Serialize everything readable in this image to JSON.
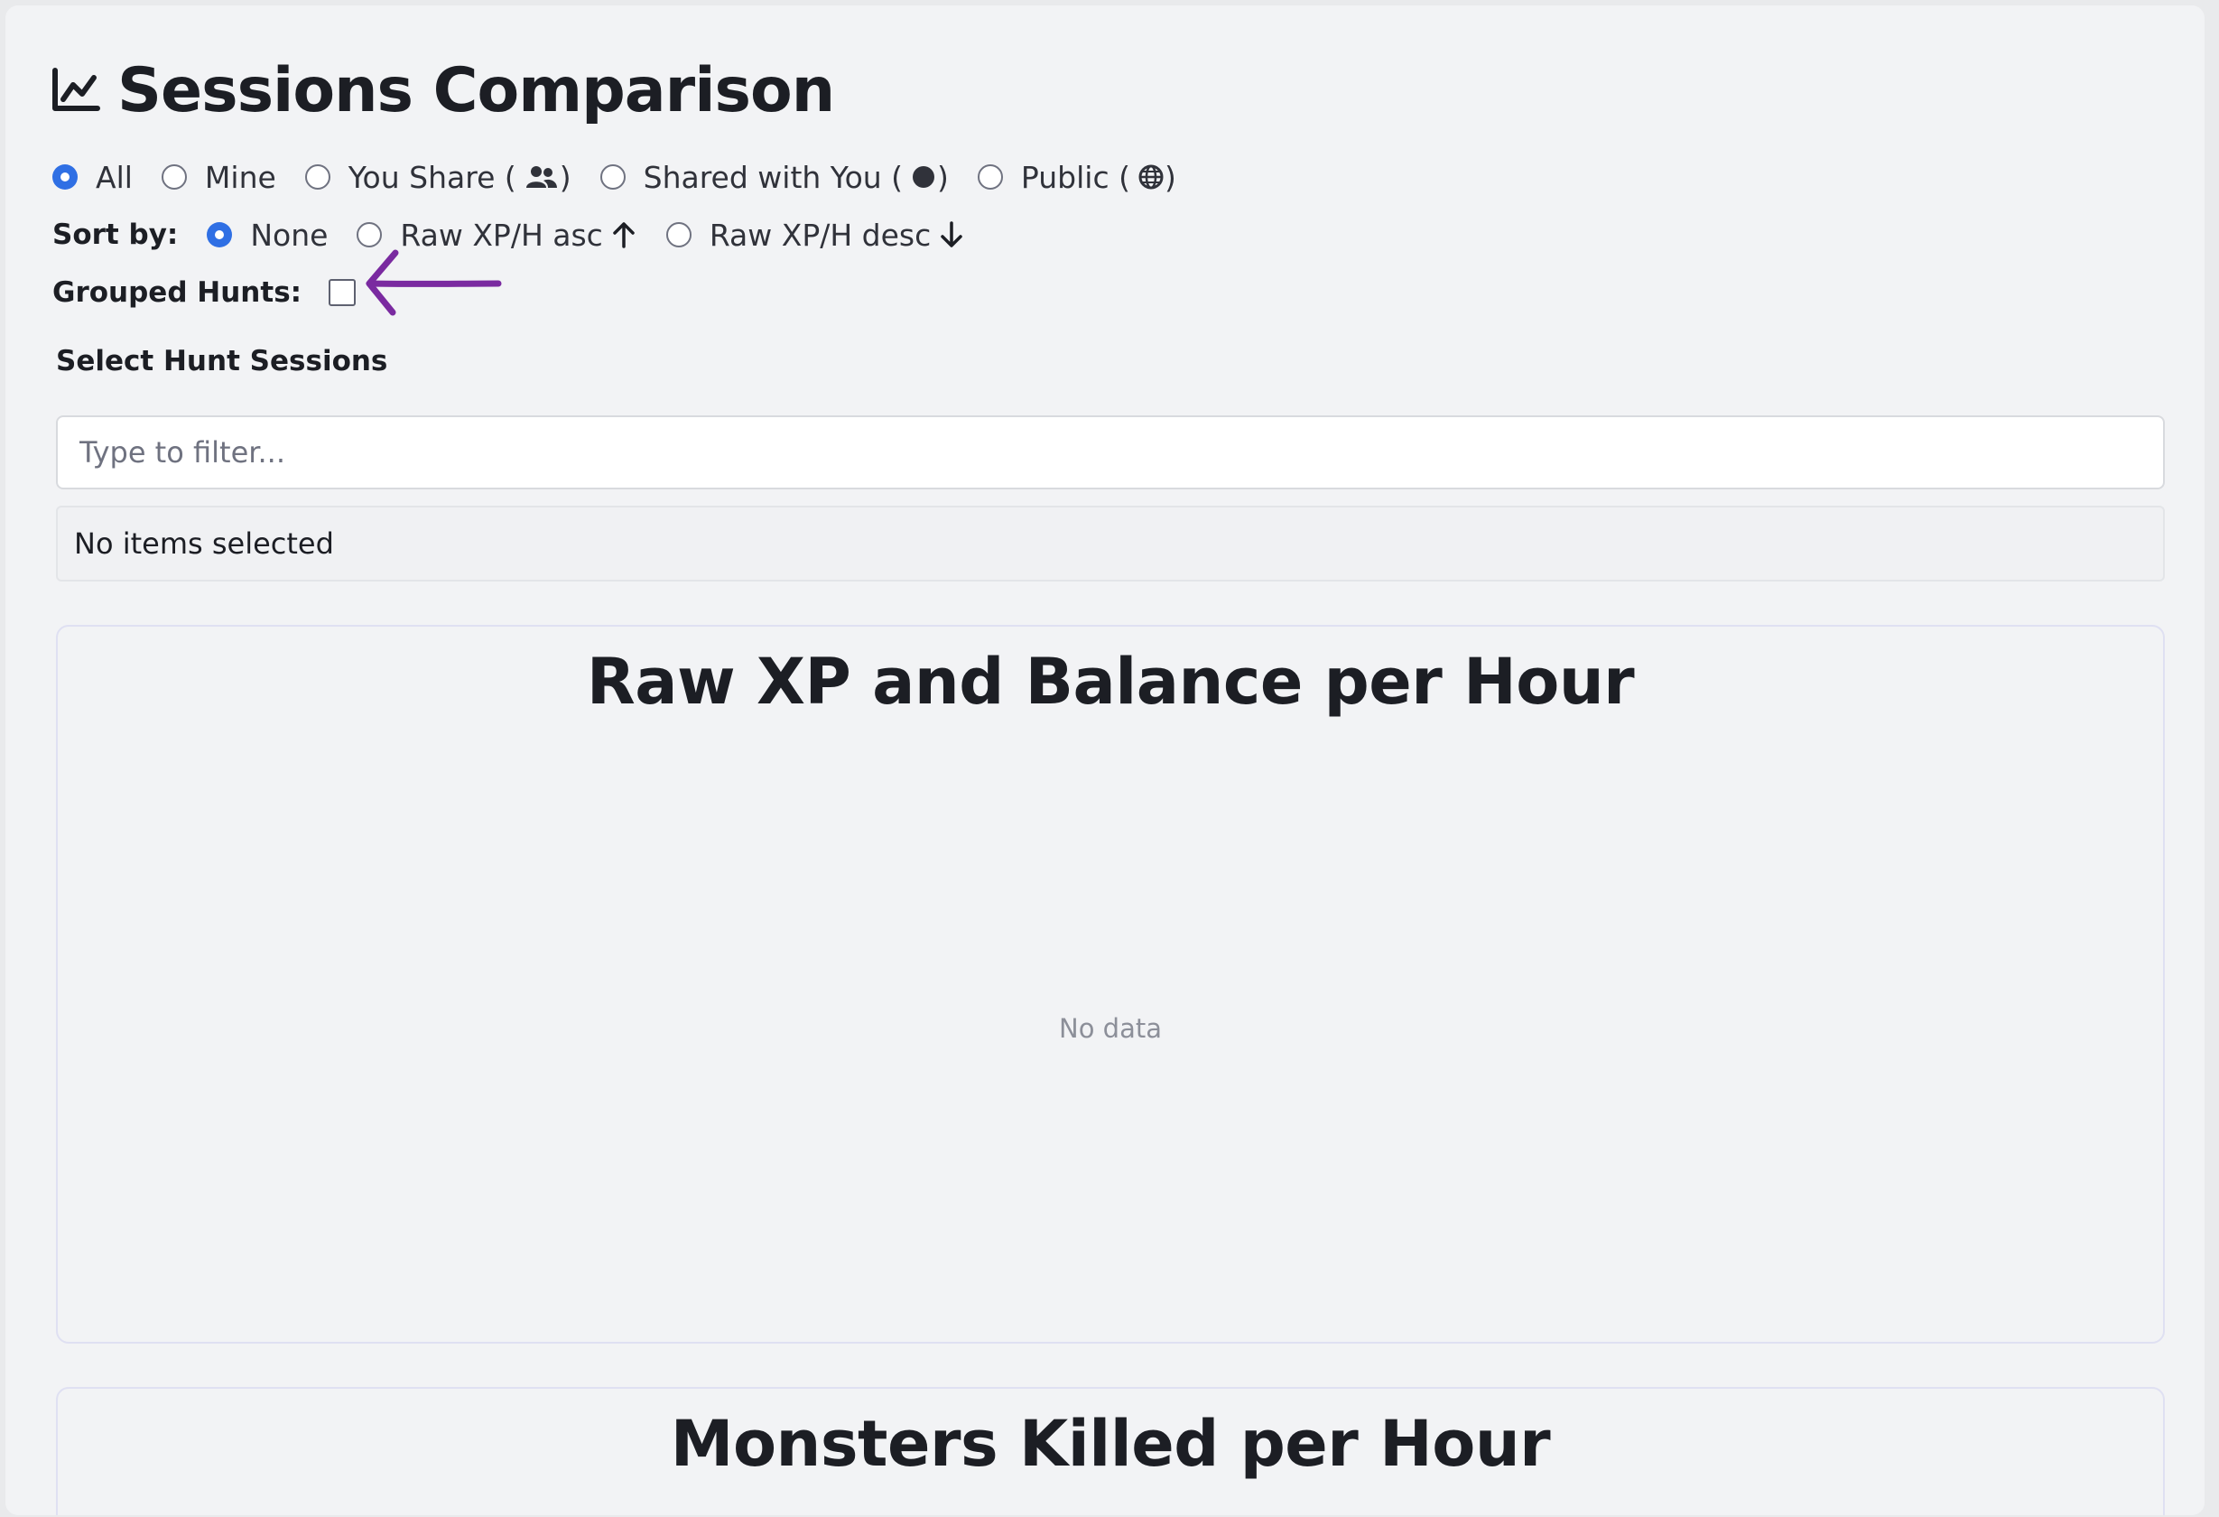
{
  "page": {
    "title": "Sessions Comparison",
    "title_icon": "line-chart-icon"
  },
  "visibility_filter": {
    "options": [
      {
        "label": "All",
        "selected": true
      },
      {
        "label": "Mine",
        "selected": false
      },
      {
        "label": "You Share (",
        "suffix": ")",
        "icon": "users-icon",
        "selected": false
      },
      {
        "label": "Shared with You (",
        "suffix": ")",
        "icon": "circle-icon",
        "selected": false
      },
      {
        "label": "Public (",
        "suffix": ")",
        "icon": "globe-icon",
        "selected": false
      }
    ]
  },
  "sort": {
    "label": "Sort by:",
    "options": [
      {
        "label": "None",
        "selected": true
      },
      {
        "label": "Raw XP/H asc",
        "icon": "arrow-up-icon",
        "selected": false
      },
      {
        "label": "Raw XP/H desc",
        "icon": "arrow-down-icon",
        "selected": false
      }
    ]
  },
  "grouped_hunts": {
    "label": "Grouped Hunts:",
    "checked": false,
    "annotation": "purple-arrow-pointer"
  },
  "sessions": {
    "label": "Select Hunt Sessions",
    "filter_placeholder": "Type to filter...",
    "selected_text": "No items selected"
  },
  "charts": [
    {
      "title": "Raw XP and Balance per Hour",
      "empty_text": "No data"
    },
    {
      "title": "Monsters Killed per Hour"
    }
  ],
  "colors": {
    "accent": "#2f6fe4",
    "annotation": "#7a2aa0",
    "background": "#f2f3f5"
  }
}
